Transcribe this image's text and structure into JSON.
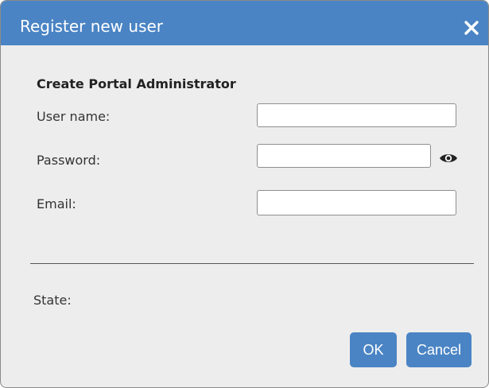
{
  "dialog": {
    "title": "Register new user",
    "close_icon": "close-icon",
    "heading": "Create Portal Administrator",
    "fields": [
      {
        "label": "User name:",
        "value": ""
      },
      {
        "label": "Password:",
        "value": "",
        "reveal_icon": "eye-icon"
      },
      {
        "label": "Email:",
        "value": ""
      }
    ],
    "state_label": "State:",
    "ok_label": "OK",
    "cancel_label": "Cancel"
  },
  "colors": {
    "accent": "#4a84c4",
    "background": "#ededed",
    "title_text": "#ffffff"
  }
}
